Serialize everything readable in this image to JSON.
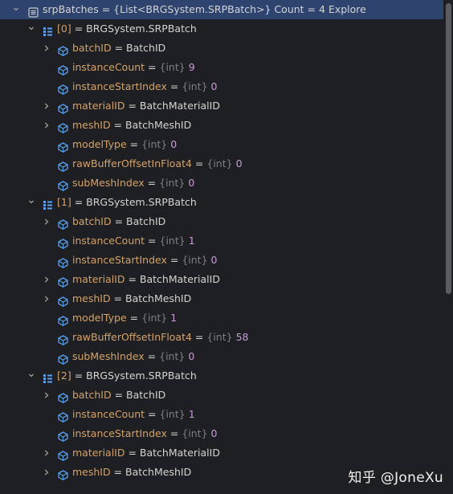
{
  "root": {
    "name": "srpBatches",
    "value": "{List<BRGSystem.SRPBatch>} Count = 4",
    "action": "Explore"
  },
  "batches": [
    {
      "index": "[0]",
      "type": "BRGSystem.SRPBatch",
      "fields": [
        {
          "name": "batchID",
          "type": "",
          "value": "BatchID"
        },
        {
          "name": "instanceCount",
          "type": "{int}",
          "value": "9"
        },
        {
          "name": "instanceStartIndex",
          "type": "{int}",
          "value": "0"
        },
        {
          "name": "materialID",
          "type": "",
          "value": "BatchMaterialID"
        },
        {
          "name": "meshID",
          "type": "",
          "value": "BatchMeshID"
        },
        {
          "name": "modelType",
          "type": "{int}",
          "value": "0"
        },
        {
          "name": "rawBufferOffsetInFloat4",
          "type": "{int}",
          "value": "0"
        },
        {
          "name": "subMeshIndex",
          "type": "{int}",
          "value": "0"
        }
      ]
    },
    {
      "index": "[1]",
      "type": "BRGSystem.SRPBatch",
      "fields": [
        {
          "name": "batchID",
          "type": "",
          "value": "BatchID"
        },
        {
          "name": "instanceCount",
          "type": "{int}",
          "value": "1"
        },
        {
          "name": "instanceStartIndex",
          "type": "{int}",
          "value": "0"
        },
        {
          "name": "materialID",
          "type": "",
          "value": "BatchMaterialID"
        },
        {
          "name": "meshID",
          "type": "",
          "value": "BatchMeshID"
        },
        {
          "name": "modelType",
          "type": "{int}",
          "value": "1"
        },
        {
          "name": "rawBufferOffsetInFloat4",
          "type": "{int}",
          "value": "58"
        },
        {
          "name": "subMeshIndex",
          "type": "{int}",
          "value": "0"
        }
      ]
    },
    {
      "index": "[2]",
      "type": "BRGSystem.SRPBatch",
      "fields": [
        {
          "name": "batchID",
          "type": "",
          "value": "BatchID"
        },
        {
          "name": "instanceCount",
          "type": "{int}",
          "value": "1"
        },
        {
          "name": "instanceStartIndex",
          "type": "{int}",
          "value": "0"
        },
        {
          "name": "materialID",
          "type": "",
          "value": "BatchMaterialID"
        },
        {
          "name": "meshID",
          "type": "",
          "value": "BatchMeshID"
        }
      ]
    }
  ],
  "watermark": "知乎 @JoneXu"
}
